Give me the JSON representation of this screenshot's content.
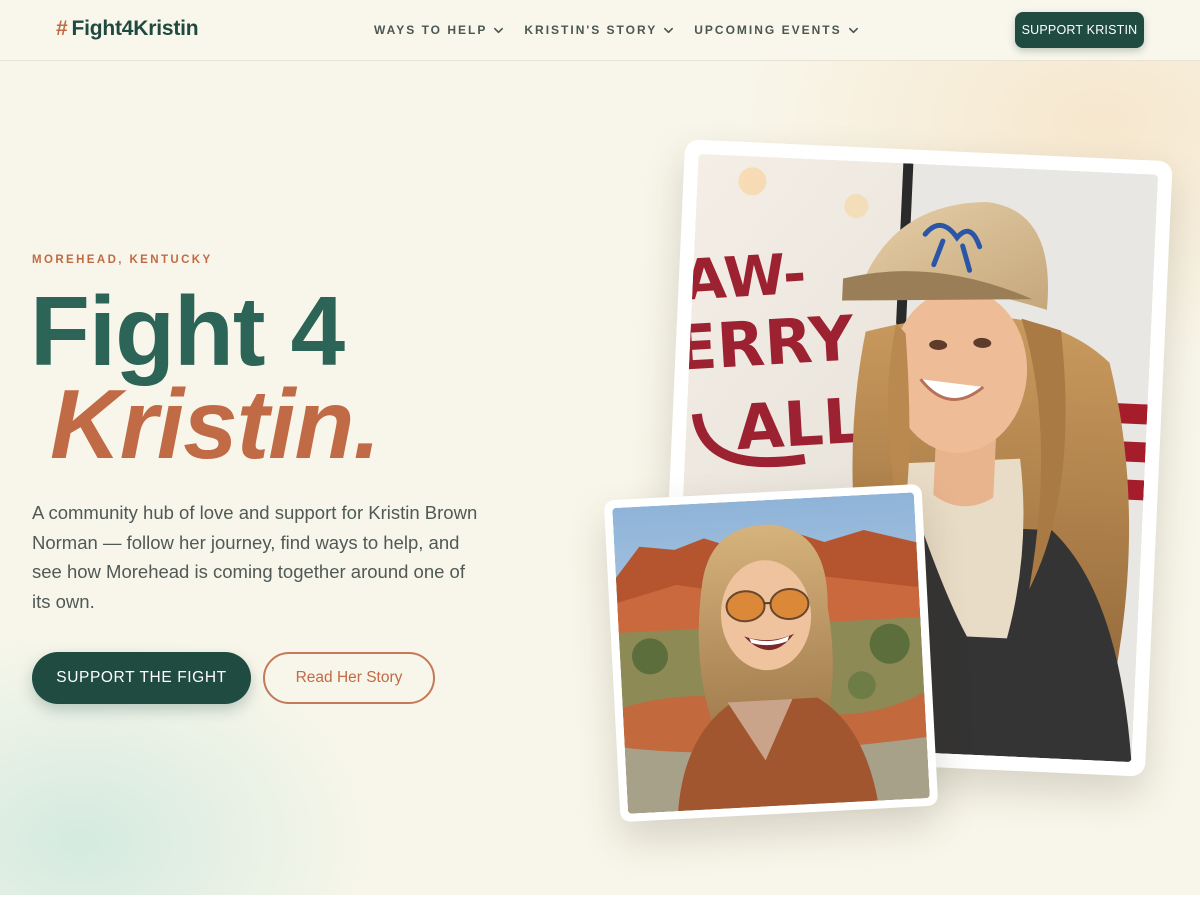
{
  "header": {
    "logo_hash": "#",
    "logo_text": "Fight4Kristin",
    "nav": [
      {
        "label": "WAYS TO HELP"
      },
      {
        "label": "KRISTIN'S STORY"
      },
      {
        "label": "UPCOMING EVENTS"
      }
    ],
    "cta_label": "SUPPORT KRISTIN"
  },
  "hero": {
    "eyebrow": "MOREHEAD, KENTUCKY",
    "title_line1": "Fight 4",
    "title_line2": "Kristin.",
    "lead": "A community hub of love and support for Kristin Brown Norman — follow her journey, find ways to help, and see how Morehead is coming together around one of its own.",
    "primary_button": "SUPPORT THE FIGHT",
    "secondary_button": "Read Her Story",
    "sign_text": "AW-ERRY ALLE"
  },
  "colors": {
    "brand_green": "#1f4b41",
    "title_green": "#2c6558",
    "accent_terracotta": "#c06b45",
    "background_cream": "#f8f6ea"
  }
}
